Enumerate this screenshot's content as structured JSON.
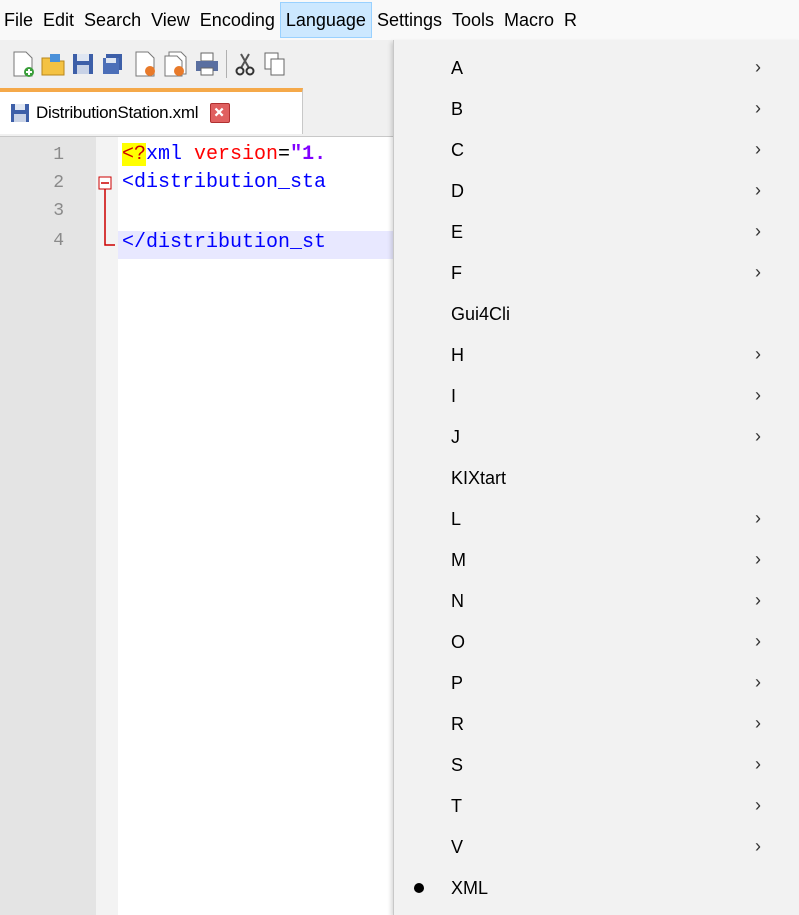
{
  "menubar": {
    "items": [
      "File",
      "Edit",
      "Search",
      "View",
      "Encoding",
      "Language",
      "Settings",
      "Tools",
      "Macro",
      "R"
    ],
    "active": "Language"
  },
  "toolbar": {
    "icons": [
      "new-file-icon",
      "open-file-icon",
      "save-icon",
      "save-all-icon",
      "close-icon",
      "close-all-icon",
      "print-icon",
      "cut-icon",
      "copy-icon"
    ]
  },
  "tabs": [
    {
      "label": "DistributionStation.xml",
      "icon": "save-icon",
      "close_icon": "close-tab-icon"
    }
  ],
  "editor": {
    "line_numbers": [
      "1",
      "2",
      "3",
      "4"
    ],
    "lines": {
      "l1": {
        "pi": "<?",
        "name": "xml ",
        "attr": "version",
        "eq": "=",
        "str": "\"1."
      },
      "l2": {
        "tag": "<distribution_sta"
      },
      "l3": {
        "text": ""
      },
      "l4": {
        "tag": "</distribution_st"
      }
    }
  },
  "language_menu": {
    "items": [
      {
        "label": "A",
        "submenu": true
      },
      {
        "label": "B",
        "submenu": true
      },
      {
        "label": "C",
        "submenu": true
      },
      {
        "label": "D",
        "submenu": true
      },
      {
        "label": "E",
        "submenu": true
      },
      {
        "label": "F",
        "submenu": true
      },
      {
        "label": "Gui4Cli",
        "submenu": false
      },
      {
        "label": "H",
        "submenu": true
      },
      {
        "label": "I",
        "submenu": true
      },
      {
        "label": "J",
        "submenu": true
      },
      {
        "label": "KIXtart",
        "submenu": false
      },
      {
        "label": "L",
        "submenu": true
      },
      {
        "label": "M",
        "submenu": true
      },
      {
        "label": "N",
        "submenu": true
      },
      {
        "label": "O",
        "submenu": true
      },
      {
        "label": "P",
        "submenu": true
      },
      {
        "label": "R",
        "submenu": true
      },
      {
        "label": "S",
        "submenu": true
      },
      {
        "label": "T",
        "submenu": true
      },
      {
        "label": "V",
        "submenu": true
      },
      {
        "label": "XML",
        "submenu": false,
        "selected": true
      }
    ],
    "chevron": "›"
  }
}
